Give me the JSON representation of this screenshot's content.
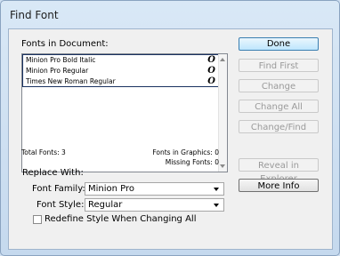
{
  "window": {
    "title": "Find Font"
  },
  "fonts_section": {
    "label": "Fonts in Document:",
    "fonts": [
      {
        "name": "Minion Pro Bold Italic",
        "icon": "opentype-font-icon",
        "glyph": "O"
      },
      {
        "name": "Minion Pro Regular",
        "icon": "opentype-font-icon",
        "glyph": "O"
      },
      {
        "name": "Times New Roman Regular",
        "icon": "opentype-font-icon",
        "glyph": "O"
      }
    ]
  },
  "stats": {
    "total_fonts": "Total Fonts: 3",
    "fonts_in_graphics": "Fonts in Graphics: 0",
    "missing_fonts": "Missing Fonts: 0"
  },
  "replace": {
    "label": "Replace With:",
    "font_family_label": "Font Family:",
    "font_family_value": "Minion Pro",
    "font_style_label": "Font Style:",
    "font_style_value": "Regular",
    "redefine_label": "Redefine Style When Changing All"
  },
  "buttons": {
    "done": "Done",
    "find_first": "Find First",
    "change": "Change",
    "change_all": "Change All",
    "change_find": "Change/Find",
    "reveal": "Reveal in Explorer",
    "more_info": "More Info"
  }
}
